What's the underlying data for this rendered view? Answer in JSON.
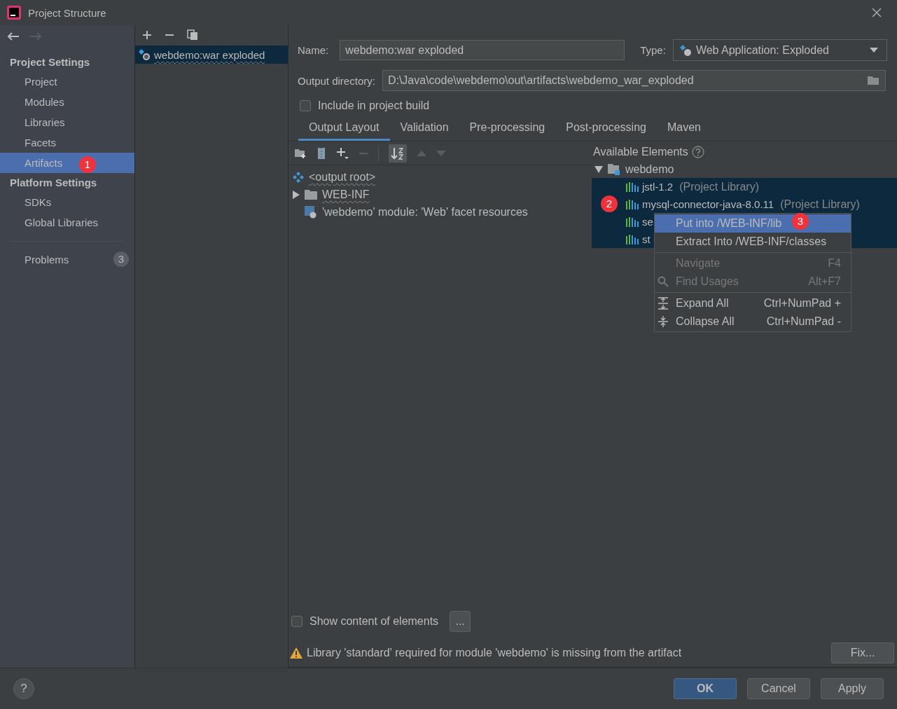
{
  "window": {
    "title": "Project Structure"
  },
  "sidebar": {
    "sections": [
      {
        "heading": "Project Settings",
        "items": [
          {
            "label": "Project",
            "selected": false
          },
          {
            "label": "Modules",
            "selected": false
          },
          {
            "label": "Libraries",
            "selected": false
          },
          {
            "label": "Facets",
            "selected": false
          },
          {
            "label": "Artifacts",
            "selected": true,
            "annotation": "1"
          }
        ]
      },
      {
        "heading": "Platform Settings",
        "items": [
          {
            "label": "SDKs",
            "selected": false
          },
          {
            "label": "Global Libraries",
            "selected": false
          }
        ]
      }
    ],
    "problems": {
      "label": "Problems",
      "count": "3"
    }
  },
  "artifacts": [
    {
      "label": "webdemo:war exploded",
      "selected": true
    }
  ],
  "form": {
    "name_label": "Name:",
    "name_value": "webdemo:war exploded",
    "type_label": "Type:",
    "type_value": "Web Application: Exploded",
    "output_label": "Output directory:",
    "output_value": "D:\\Java\\code\\webdemo\\out\\artifacts\\webdemo_war_exploded",
    "include": {
      "label": "Include in project build",
      "checked": false
    }
  },
  "tabs": [
    {
      "label": "Output Layout",
      "selected": true
    },
    {
      "label": "Validation",
      "selected": false
    },
    {
      "label": "Pre-processing",
      "selected": false
    },
    {
      "label": "Post-processing",
      "selected": false
    },
    {
      "label": "Maven",
      "selected": false
    }
  ],
  "layout_tree": [
    {
      "label": "<output root>",
      "kind": "root",
      "children": [
        {
          "label": "WEB-INF",
          "kind": "folder",
          "expanded": false
        },
        {
          "label": "'webdemo' module: 'Web' facet resources",
          "kind": "facet"
        }
      ]
    }
  ],
  "available": {
    "heading": "Available Elements",
    "tree": {
      "label": "webdemo",
      "expanded": true,
      "children": [
        {
          "name": "jstl-1.2",
          "suffix": "(Project Library)",
          "selected": true
        },
        {
          "name": "mysql-connector-java-8.0.11",
          "suffix": "(Project Library)",
          "selected": true,
          "annotation": "2"
        },
        {
          "name": "se",
          "selected": true
        },
        {
          "name": "st",
          "selected": true
        }
      ]
    }
  },
  "context_menu": [
    {
      "kind": "plain",
      "label": "Put into /WEB-INF/lib",
      "selected": true,
      "disabled": false,
      "annotation": "3"
    },
    {
      "kind": "plain",
      "label": "Extract Into /WEB-INF/classes",
      "selected": false,
      "disabled": false
    },
    {
      "kind": "separator"
    },
    {
      "kind": "plain",
      "label": "Navigate",
      "shortcut": "F4",
      "selected": false,
      "disabled": true
    },
    {
      "kind": "search",
      "label": "Find Usages",
      "shortcut": "Alt+F7",
      "selected": false,
      "disabled": true
    },
    {
      "kind": "separator"
    },
    {
      "kind": "expand",
      "label": "Expand All",
      "shortcut": "Ctrl+NumPad +",
      "selected": false,
      "disabled": false
    },
    {
      "kind": "collapse",
      "label": "Collapse All",
      "shortcut": "Ctrl+NumPad -",
      "selected": false,
      "disabled": false
    }
  ],
  "show_content": {
    "label": "Show content of elements",
    "checked": false,
    "button": "..."
  },
  "warning": {
    "text": "Library 'standard' required for module 'webdemo' is missing from the artifact",
    "fix": "Fix..."
  },
  "buttons": [
    {
      "label": "OK",
      "kind": "primary"
    },
    {
      "label": "Cancel",
      "kind": "normal"
    },
    {
      "label": "Apply",
      "kind": "normal"
    }
  ],
  "help": "?"
}
